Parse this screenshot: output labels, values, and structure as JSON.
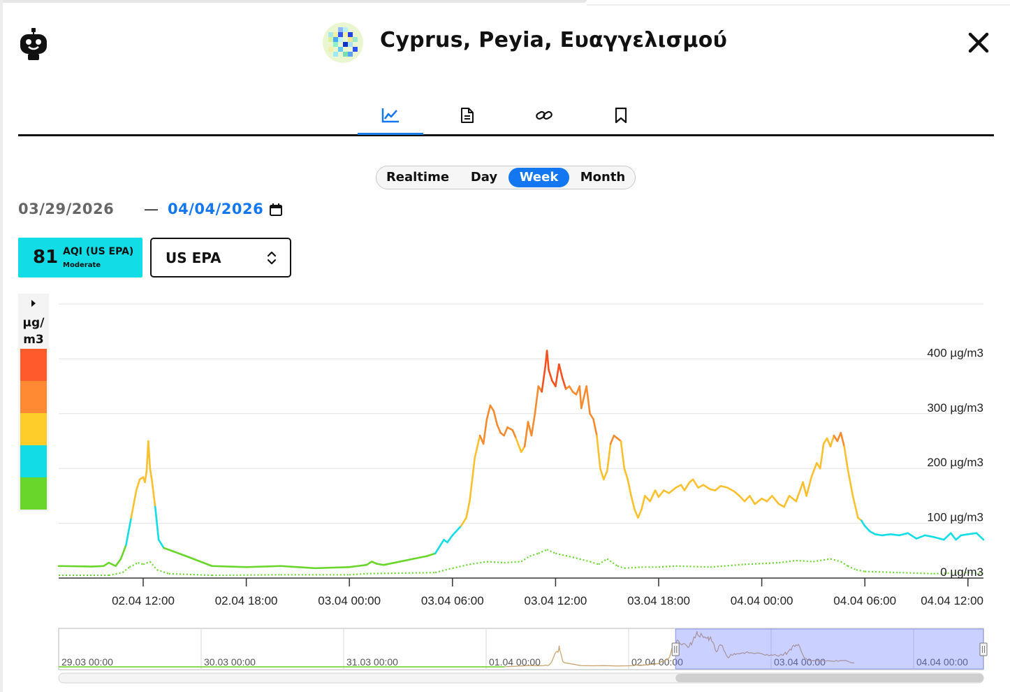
{
  "window": {
    "title": "Cyprus, Peyia, Ευαγγελισμού",
    "close_icon": "close-icon",
    "app_icon": "robot-icon"
  },
  "tabs": [
    {
      "icon": "chart-icon",
      "active": true
    },
    {
      "icon": "document-icon",
      "active": false
    },
    {
      "icon": "link-icon",
      "active": false
    },
    {
      "icon": "bookmark-icon",
      "active": false
    }
  ],
  "period": {
    "options": [
      "Realtime",
      "Day",
      "Week",
      "Month"
    ],
    "selected": "Week"
  },
  "dates": {
    "from": "03/29/2026",
    "to": "04/04/2026",
    "calendar_icon": "calendar-icon"
  },
  "aqi": {
    "value": "81",
    "label": "AQI (US EPA)",
    "level": "Moderate",
    "color": "#12dde6"
  },
  "standard": {
    "selected": "US EPA"
  },
  "legend": {
    "unit_line1": "µg/",
    "unit_line2": "m3",
    "colors": [
      "#ff5a2b",
      "#ff8a33",
      "#ffcd2a",
      "#12dde6",
      "#68d62a"
    ]
  },
  "chart_data": {
    "type": "line",
    "y_unit": "µg/m3",
    "ylim": [
      0,
      500
    ],
    "y_ticks": [
      {
        "value": 100,
        "label": "100 µg/m3"
      },
      {
        "value": 200,
        "label": "200 µg/m3"
      },
      {
        "value": 300,
        "label": "300 µg/m3"
      },
      {
        "value": 400,
        "label": "400 µg/m3"
      },
      {
        "value": 0,
        "label": "0 µg/m3"
      }
    ],
    "x_range_hours": [
      -8.3,
      37.2
    ],
    "x_ticks": [
      {
        "hour": 0,
        "label": "02.04 12:00"
      },
      {
        "hour": 6,
        "label": "02.04 18:00"
      },
      {
        "hour": 12,
        "label": "03.04 00:00"
      },
      {
        "hour": 18,
        "label": "03.04 06:00"
      },
      {
        "hour": 24,
        "label": "03.04 12:00"
      },
      {
        "hour": 30,
        "label": "03.04 18:00"
      },
      {
        "hour": 36,
        "label": "04.04 00:00"
      },
      {
        "hour": 42,
        "label": "04.04 06:00"
      },
      {
        "hour": 48,
        "label": "04.04 12:00"
      }
    ],
    "color_thresholds": [
      {
        "max": 50,
        "color": "#68d62a"
      },
      {
        "max": 100,
        "color": "#12dde6"
      },
      {
        "max": 250,
        "color": "#fbc02d"
      },
      {
        "max": 350,
        "color": "#f58a2e"
      },
      {
        "max": 1000,
        "color": "#f4511e"
      }
    ],
    "series": [
      {
        "style": "solid",
        "points": [
          [
            -5,
            22
          ],
          [
            -3,
            21
          ],
          [
            -2.3,
            22
          ],
          [
            -2,
            28
          ],
          [
            -1.6,
            22
          ],
          [
            -1.3,
            35
          ],
          [
            -1,
            60
          ],
          [
            -0.7,
            110
          ],
          [
            -0.4,
            160
          ],
          [
            -0.2,
            180
          ],
          [
            0,
            184
          ],
          [
            0.1,
            175
          ],
          [
            0.2,
            195
          ],
          [
            0.3,
            250
          ],
          [
            0.4,
            200
          ],
          [
            0.5,
            180
          ],
          [
            0.7,
            130
          ],
          [
            0.9,
            70
          ],
          [
            1.2,
            55
          ],
          [
            2.5,
            40
          ],
          [
            4,
            22
          ],
          [
            6,
            20
          ],
          [
            8,
            22
          ],
          [
            9,
            20
          ],
          [
            10,
            18
          ],
          [
            12,
            20
          ],
          [
            12.5,
            22
          ],
          [
            13,
            24
          ],
          [
            13.3,
            30
          ],
          [
            13.6,
            26
          ],
          [
            14,
            24
          ],
          [
            16.5,
            40
          ],
          [
            17,
            45
          ],
          [
            17.3,
            60
          ],
          [
            17.5,
            70
          ],
          [
            17.7,
            65
          ],
          [
            18,
            78
          ],
          [
            18.5,
            95
          ],
          [
            18.8,
            110
          ],
          [
            19,
            140
          ],
          [
            19.3,
            220
          ],
          [
            19.6,
            260
          ],
          [
            19.8,
            245
          ],
          [
            20,
            290
          ],
          [
            20.2,
            315
          ],
          [
            20.4,
            305
          ],
          [
            20.6,
            280
          ],
          [
            20.8,
            265
          ],
          [
            21,
            260
          ],
          [
            21.2,
            275
          ],
          [
            21.5,
            270
          ],
          [
            21.7,
            255
          ],
          [
            22,
            230
          ],
          [
            22.2,
            240
          ],
          [
            22.4,
            285
          ],
          [
            22.6,
            260
          ],
          [
            22.8,
            300
          ],
          [
            23,
            350
          ],
          [
            23.2,
            340
          ],
          [
            23.4,
            385
          ],
          [
            23.5,
            415
          ],
          [
            23.6,
            380
          ],
          [
            23.8,
            360
          ],
          [
            24,
            350
          ],
          [
            24.2,
            390
          ],
          [
            24.4,
            365
          ],
          [
            24.6,
            345
          ],
          [
            24.8,
            350
          ],
          [
            25,
            340
          ],
          [
            25.2,
            335
          ],
          [
            25.4,
            350
          ],
          [
            25.5,
            310
          ],
          [
            25.8,
            350
          ],
          [
            26,
            300
          ],
          [
            26.2,
            290
          ],
          [
            26.4,
            260
          ],
          [
            26.6,
            200
          ],
          [
            26.8,
            180
          ],
          [
            27,
            195
          ],
          [
            27.2,
            245
          ],
          [
            27.4,
            260
          ],
          [
            27.6,
            255
          ],
          [
            27.8,
            250
          ],
          [
            28,
            200
          ],
          [
            28.2,
            180
          ],
          [
            28.4,
            150
          ],
          [
            28.6,
            125
          ],
          [
            28.8,
            110
          ],
          [
            29,
            125
          ],
          [
            29.2,
            150
          ],
          [
            29.5,
            140
          ],
          [
            29.8,
            160
          ],
          [
            30,
            148
          ],
          [
            30.3,
            160
          ],
          [
            30.6,
            155
          ],
          [
            31,
            165
          ],
          [
            31.3,
            170
          ],
          [
            31.5,
            160
          ],
          [
            31.8,
            175
          ],
          [
            32,
            180
          ],
          [
            32.3,
            165
          ],
          [
            32.6,
            170
          ],
          [
            33,
            162
          ],
          [
            33.3,
            160
          ],
          [
            33.6,
            168
          ],
          [
            34,
            165
          ],
          [
            34.4,
            158
          ],
          [
            34.7,
            150
          ],
          [
            35,
            140
          ],
          [
            35.3,
            150
          ],
          [
            35.6,
            135
          ],
          [
            36,
            145
          ],
          [
            36.3,
            140
          ],
          [
            36.6,
            150
          ],
          [
            37,
            135
          ],
          [
            37.3,
            130
          ],
          [
            37.6,
            150
          ],
          [
            38,
            140
          ],
          [
            38.4,
            175
          ],
          [
            38.6,
            150
          ],
          [
            38.9,
            185
          ],
          [
            39.2,
            210
          ],
          [
            39.4,
            200
          ],
          [
            39.6,
            245
          ],
          [
            39.8,
            255
          ],
          [
            40,
            240
          ],
          [
            40.2,
            260
          ],
          [
            40.4,
            250
          ],
          [
            40.6,
            265
          ],
          [
            40.8,
            240
          ],
          [
            41,
            200
          ],
          [
            41.3,
            150
          ],
          [
            41.6,
            110
          ],
          [
            41.8,
            105
          ],
          [
            42,
            95
          ],
          [
            42.3,
            85
          ],
          [
            42.6,
            80
          ],
          [
            43,
            78
          ],
          [
            43.5,
            80
          ],
          [
            44,
            78
          ],
          [
            44.5,
            82
          ],
          [
            45,
            72
          ],
          [
            45.5,
            78
          ],
          [
            46,
            75
          ],
          [
            46.6,
            70
          ],
          [
            47,
            82
          ],
          [
            47.3,
            70
          ],
          [
            47.6,
            78
          ],
          [
            48,
            80
          ],
          [
            48.5,
            82
          ],
          [
            49,
            70
          ],
          [
            49.5,
            55
          ],
          [
            50,
            52
          ]
        ]
      },
      {
        "style": "dotted",
        "points": [
          [
            -5,
            5
          ],
          [
            -2,
            5
          ],
          [
            -1.2,
            10
          ],
          [
            -0.8,
            20
          ],
          [
            -0.3,
            28
          ],
          [
            0,
            25
          ],
          [
            0.4,
            30
          ],
          [
            0.8,
            15
          ],
          [
            1.5,
            8
          ],
          [
            4,
            5
          ],
          [
            8,
            6
          ],
          [
            12,
            6
          ],
          [
            13,
            8
          ],
          [
            17,
            10
          ],
          [
            18,
            18
          ],
          [
            19,
            25
          ],
          [
            20,
            30
          ],
          [
            21,
            28
          ],
          [
            22,
            30
          ],
          [
            22.5,
            40
          ],
          [
            23,
            45
          ],
          [
            23.5,
            52
          ],
          [
            24,
            45
          ],
          [
            25,
            38
          ],
          [
            26,
            30
          ],
          [
            26.5,
            25
          ],
          [
            27,
            35
          ],
          [
            27.6,
            22
          ],
          [
            28,
            18
          ],
          [
            29,
            20
          ],
          [
            30,
            20
          ],
          [
            31,
            22
          ],
          [
            33,
            20
          ],
          [
            35,
            25
          ],
          [
            37,
            28
          ],
          [
            38,
            32
          ],
          [
            39,
            30
          ],
          [
            40,
            35
          ],
          [
            40.6,
            30
          ],
          [
            41,
            22
          ],
          [
            41.5,
            15
          ],
          [
            42,
            12
          ],
          [
            44,
            10
          ],
          [
            46,
            8
          ],
          [
            48,
            10
          ],
          [
            50,
            8
          ]
        ]
      }
    ]
  },
  "navigator": {
    "labels": [
      "29.03 00:00",
      "30.03 00:00",
      "31.03 00:00",
      "01.04 00:00",
      "02.04 00:00",
      "03.04 00:00",
      "04.04 00:00"
    ],
    "selection_start": 0.655,
    "selection_end": 1.0
  }
}
